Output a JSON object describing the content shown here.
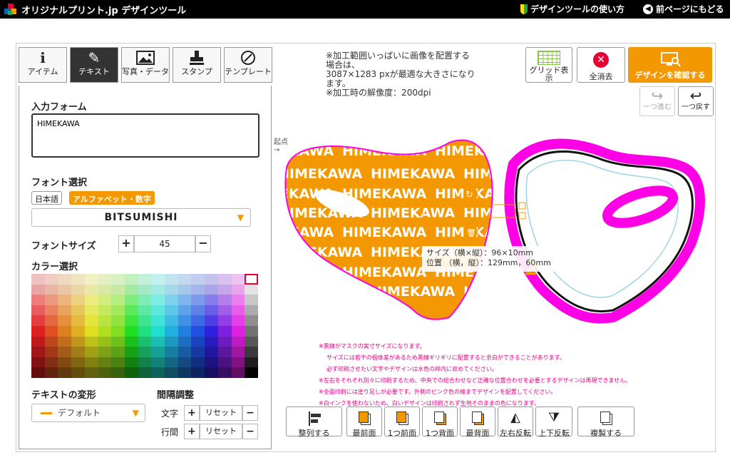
{
  "header": {
    "logo_text": "オリジナルプリント.jp デザインツール",
    "help_link": "デザインツールの使い方",
    "back_link": "前ページにもどる"
  },
  "tabs": [
    {
      "label": "アイテム",
      "icon": "info-icon"
    },
    {
      "label": "テキスト",
      "icon": "pen-icon"
    },
    {
      "label": "写真・データ",
      "icon": "image-icon"
    },
    {
      "label": "スタンプ",
      "icon": "stamp-icon"
    },
    {
      "label": "テンプレート",
      "icon": "template-icon"
    }
  ],
  "text_panel": {
    "input_label": "入力フォーム",
    "input_value": "HIMEKAWA",
    "font_label": "フォント選択",
    "font_tab_ja": "日本語",
    "font_tab_alpha": "アルファベット・数字",
    "font_selected": "BITSUMISHI",
    "size_label": "フォントサイズ",
    "size_value": "45",
    "color_label": "カラー選択",
    "transform_label": "テキストの変形",
    "transform_value": "デフォルト",
    "spacing_label": "間隔調整",
    "char_label": "文字",
    "line_label": "行間",
    "reset_label": "リセット",
    "plus": "+",
    "minus": "−"
  },
  "canvas": {
    "notes": [
      "※加工範囲いっぱいに画像を配置する",
      "場合は、",
      "3087×1283 pxが最適な大きさになり",
      "ます。",
      "※加工時の解像度：200dpi"
    ],
    "origin_label": "起点",
    "tooltip_size": "サイズ（横×縦）：96×10mm",
    "tooltip_pos": "位置 （横，縦）：129mm，60mm",
    "design_text": "HIMEKAWA"
  },
  "toolbar_right": {
    "grid": "グリッド表示",
    "clear": "全消去",
    "confirm": "デザインを確認する",
    "redo": "一つ進む",
    "undo": "一つ戻す"
  },
  "mask_notes": [
    "※黒線がマスクの実寸サイズになります。",
    "サイズには若干の個体差があるため黒線ギリギリに配置すると余白ができることがあります。",
    "必ず印刷させたい文字やデザインは水色の枠内に収めてください。",
    "※左右をそれぞれ別々に印刷するため、中央での総合わせなど正確な位置合わせを必要とするデザインは再現できません。",
    "※全面印刷には塗り足しが必要です。外側のピンク色の線までデザインを配置してください。",
    "※白インクを使わないため、白いデザインは印刷されず生地そのままの色になります。"
  ],
  "bottom_toolbar": [
    "整列する",
    "最前面",
    "1つ前面",
    "1つ背面",
    "最背面",
    "左右反転",
    "上下反転",
    "複製する"
  ],
  "colors": {
    "accent": "#f39800",
    "mask_pink": "#ff00e6",
    "active_tab": "#333333"
  }
}
